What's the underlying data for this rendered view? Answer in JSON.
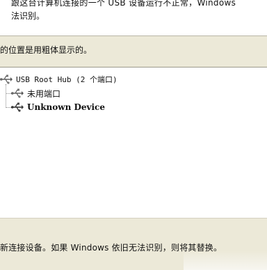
{
  "banner": {
    "line1": "跟这台计算机连接的一个 USB 设备运行不正常，Windows",
    "line2": "法识别。"
  },
  "instructions": {
    "top": "的位置是用粗体显示的。",
    "bottom": "新连接设备。如果 Windows 依旧无法识别，则将其替换。"
  },
  "tree": {
    "root": {
      "label": "USB Root Hub (2 个端口)",
      "icon": "usb-icon"
    },
    "children": [
      {
        "label": "未用端口",
        "icon": "usb-icon",
        "bold": false
      },
      {
        "label": "Unknown Device",
        "icon": "usb-icon",
        "bold": true
      }
    ]
  }
}
